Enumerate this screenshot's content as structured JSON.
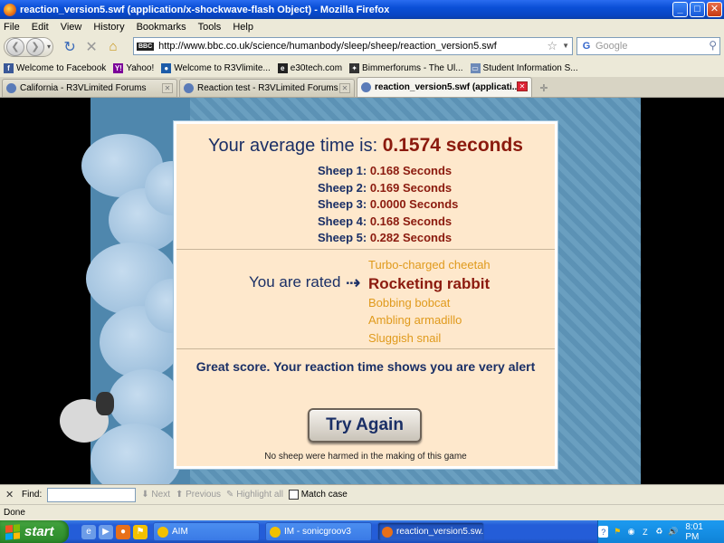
{
  "window": {
    "title": "reaction_version5.swf (application/x-shockwave-flash Object) - Mozilla Firefox",
    "minimize": "_",
    "maximize": "□",
    "close": "✕"
  },
  "menu": [
    "File",
    "Edit",
    "View",
    "History",
    "Bookmarks",
    "Tools",
    "Help"
  ],
  "nav": {
    "url": "http://www.bbc.co.uk/science/humanbody/sleep/sheep/reaction_version5.swf",
    "site_badge": "BBC",
    "search_placeholder": "Google"
  },
  "bookmarks": [
    {
      "label": "Welcome to Facebook",
      "icon": "facebook-icon",
      "color": "#3b5998",
      "glyph": "f"
    },
    {
      "label": "Yahoo!",
      "icon": "yahoo-icon",
      "color": "#7b0099",
      "glyph": "Y!"
    },
    {
      "label": "Welcome to R3Vlimite...",
      "icon": "bmw-icon",
      "color": "#1c5ba8",
      "glyph": "●"
    },
    {
      "label": "e30tech.com",
      "icon": "e30tech-icon",
      "color": "#222222",
      "glyph": "e"
    },
    {
      "label": "Bimmerforums - The Ul...",
      "icon": "bimmerforums-icon",
      "color": "#333333",
      "glyph": "✦"
    },
    {
      "label": "Student Information S...",
      "icon": "page-icon",
      "color": "#6d8ab8",
      "glyph": "▭"
    }
  ],
  "tabs": [
    {
      "label": "California - R3VLimited Forums",
      "active": false
    },
    {
      "label": "Reaction test - R3VLimited Forums",
      "active": false
    },
    {
      "label": "reaction_version5.swf (applicati...",
      "active": true
    }
  ],
  "result": {
    "avg_label": "Your average time is:",
    "avg_value": "0.1574 seconds",
    "sheep": [
      {
        "label": "Sheep 1:",
        "value": "0.168 Seconds"
      },
      {
        "label": "Sheep 2:",
        "value": "0.169 Seconds"
      },
      {
        "label": "Sheep 3:",
        "value": "0.0000 Seconds"
      },
      {
        "label": "Sheep 4:",
        "value": "0.168 Seconds"
      },
      {
        "label": "Sheep 5:",
        "value": "0.282 Seconds"
      }
    ],
    "rated_label": "You are rated",
    "ratings": [
      {
        "label": "Turbo-charged cheetah",
        "current": false
      },
      {
        "label": "Rocketing rabbit",
        "current": true
      },
      {
        "label": "Bobbing bobcat",
        "current": false
      },
      {
        "label": "Ambling armadillo",
        "current": false
      },
      {
        "label": "Sluggish snail",
        "current": false
      }
    ],
    "message": "Great score. Your reaction time shows you are very alert",
    "try_again": "Try Again",
    "disclaimer": "No sheep were harmed in the making of this game"
  },
  "findbar": {
    "label": "Find:",
    "next": "Next",
    "previous": "Previous",
    "highlight": "Highlight all",
    "match_case": "Match case"
  },
  "status": "Done",
  "taskbar": {
    "start": "start",
    "tasks": [
      {
        "label": "AIM",
        "width": 118,
        "active": false,
        "color": "#f2c100"
      },
      {
        "label": "IM - sonicgroov3",
        "width": 118,
        "active": false,
        "color": "#f2c100"
      },
      {
        "label": "reaction_version5.sw...",
        "width": 118,
        "active": true,
        "color": "#e8701a"
      }
    ],
    "clock": "8:01 PM"
  },
  "colors": {
    "navy_text": "#1a2f66",
    "value_red": "#8b1a0e",
    "rating_orange": "#e09a1c",
    "panel_bg": "#fee8cc"
  }
}
